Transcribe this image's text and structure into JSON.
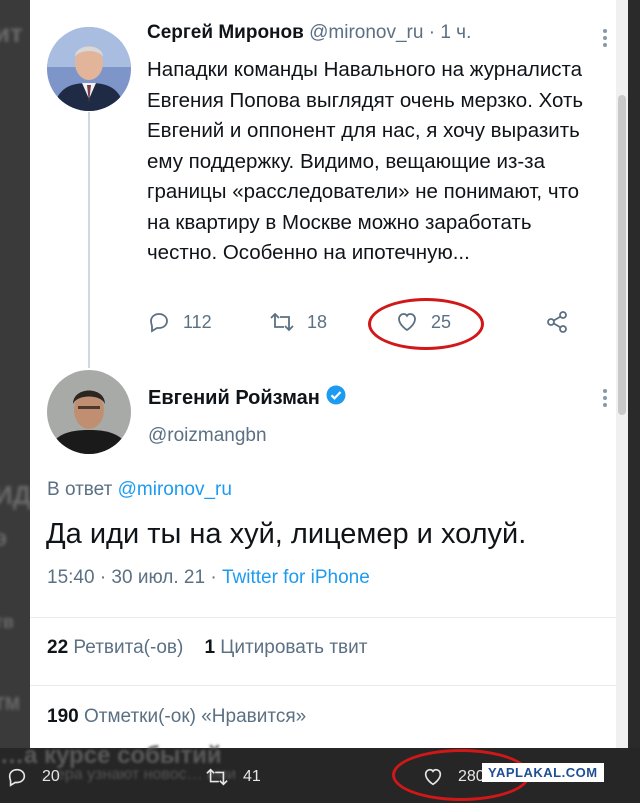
{
  "tweet1": {
    "author_name": "Сергей Миронов",
    "handle_time": "@mironov_ru · 1 ч.",
    "text": "Нападки команды Навального на журналиста Евгения Попова выглядят очень мерзко. Хоть Евгений и оппонент для нас, я хочу выразить ему поддержку. Видимо, вещающие из-за границы «расследователи» не понимают, что на квартиру в Москве можно заработать честно. Особенно на ипотечную...",
    "replies": "112",
    "retweets": "18",
    "likes": "25"
  },
  "tweet2": {
    "author_name": "Евгений Ройзман",
    "handle": "@roizmangbn",
    "reply_prefix": "В ответ",
    "reply_handle": "@mironov_ru",
    "text": "Да иди ты на хуй, лицемер и холуй.",
    "time_date": "15:40 · 30 июл. 21 · ",
    "source": "Twitter for iPhone",
    "retweets_count": "22",
    "retweets_label": "Ретвита(-ов)",
    "quotes_count": "1",
    "quotes_label": "Цитировать твит",
    "likes_count": "190",
    "likes_label": "Отметки(-ок) «Нравится»"
  },
  "background": {
    "bottom_heading": "…а курсе событий",
    "bottom_sub": "…ера узнают новос… ими",
    "left_fragments": [
      "ит",
      "ИД",
      "Э",
      "тв",
      "ТМ"
    ]
  },
  "bottom_bar": {
    "replies": "20",
    "retweets": "41",
    "likes": "280"
  },
  "watermark": "YAPLAKAL.COM",
  "colors": {
    "accent": "#1d9bf0",
    "circle": "#d11717",
    "text": "#0f1419",
    "muted": "#5b7083"
  }
}
